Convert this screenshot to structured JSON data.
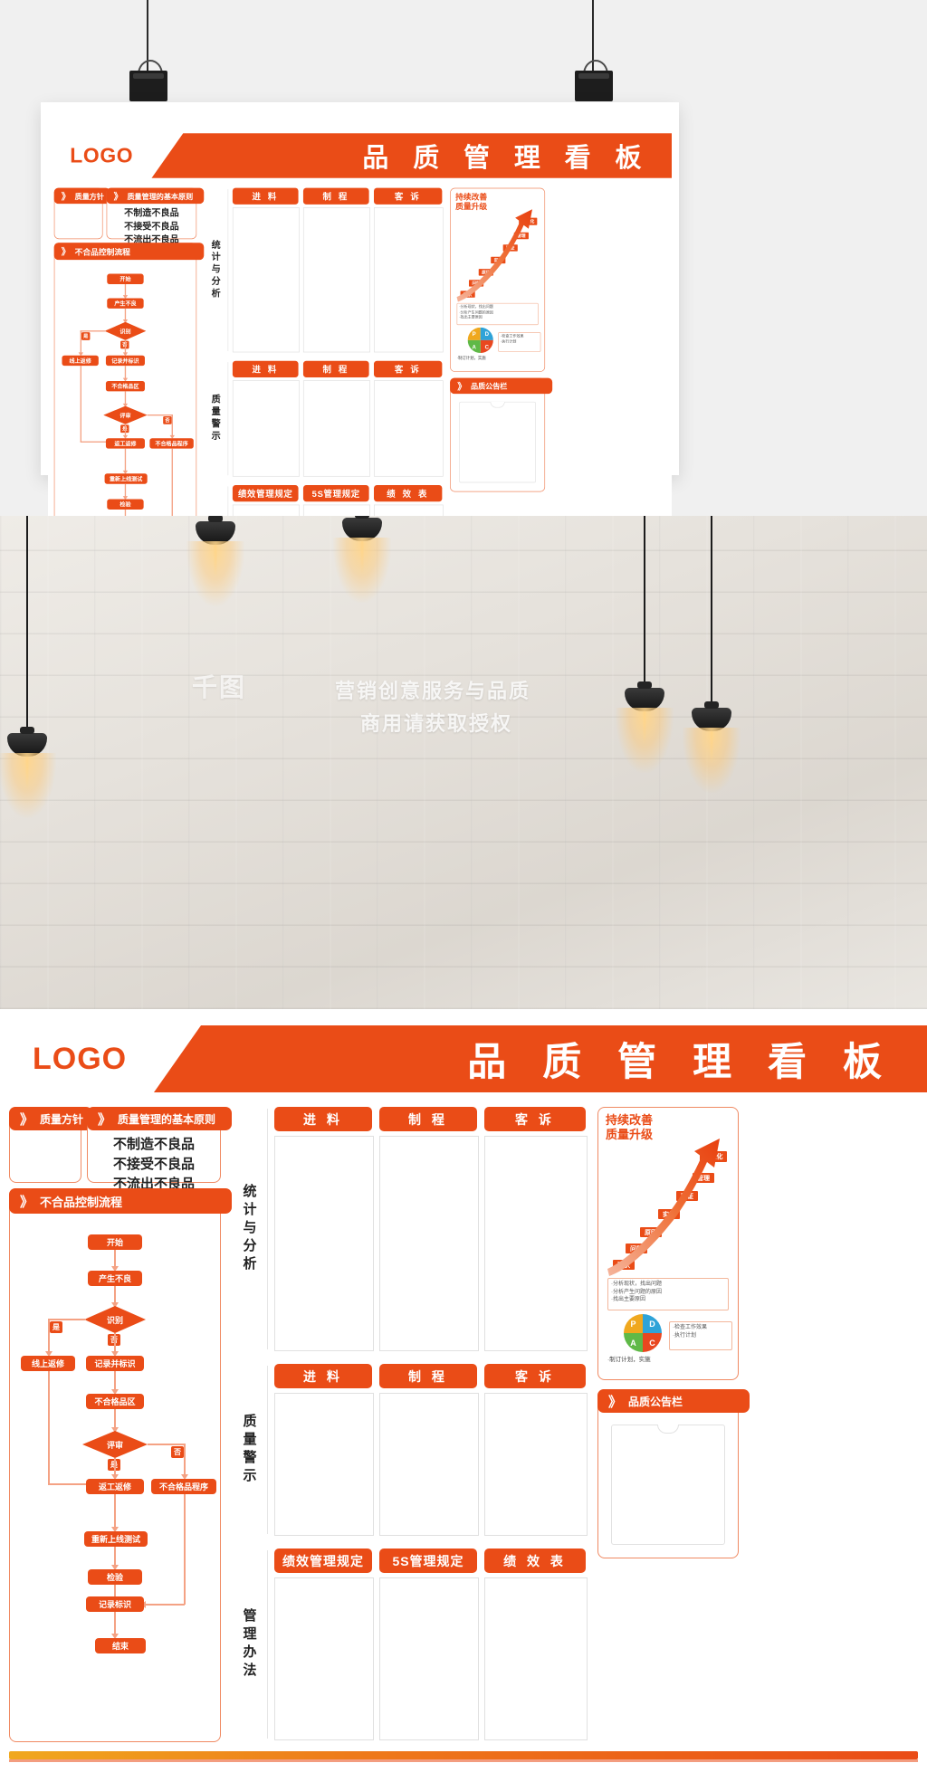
{
  "brand": {
    "logo": "LOGO",
    "accent": "#ea4c17",
    "accent_light": "#f4a284",
    "gold": "#f0a81e"
  },
  "board": {
    "title": "品 质 管 理 看 板",
    "left": {
      "policy": {
        "header": "质量方针",
        "chevron": "》"
      },
      "principle": {
        "header": "质量管理的基本原则",
        "chevron": "》",
        "lines": [
          "不制造不良品",
          "不接受不良品",
          "不流出不良品"
        ]
      },
      "flow": {
        "header": "不合品控制流程",
        "chevron": "》",
        "nodes": [
          "开始",
          "产生不良",
          "识别",
          "线上返修",
          "记录并标识",
          "不合格品区",
          "评审",
          "返工返修",
          "不合格品程序",
          "重新上线测试",
          "检验",
          "记录标识",
          "结束"
        ],
        "branch_yes": "是",
        "branch_no": "否",
        "branch_no2": "否",
        "branch_yes2": "是"
      }
    },
    "sections": [
      {
        "label": "统计与分析",
        "columns": [
          "进 料",
          "制 程",
          "客 诉"
        ]
      },
      {
        "label": "质量警示",
        "columns": [
          "进 料",
          "制 程",
          "客 诉"
        ]
      },
      {
        "label": "管理办法",
        "columns": [
          "绩效管理规定",
          "5S管理规定",
          "绩 效 表"
        ]
      }
    ],
    "right": {
      "improve": {
        "title_line1": "持续改善",
        "title_line2": "质量升级",
        "steps": [
          "现状",
          "问题",
          "原因",
          "实施",
          "验证",
          "管理",
          "标准化"
        ],
        "pdca": [
          "P",
          "D",
          "C",
          "A"
        ],
        "pdca_colors": [
          "#f0a81e",
          "#2fa3d8",
          "#e9471f",
          "#5fb947"
        ],
        "notes": [
          "·分析现状，找出问题",
          "·分析产生问题的原因",
          "·找出主要原因",
          "·制订计划，实施"
        ],
        "notes2": [
          "·检查工作效果",
          "·执行计划"
        ]
      },
      "notice": {
        "header": "品质公告栏",
        "chevron": "》"
      }
    }
  },
  "mockup": {
    "watermark_line1": "营销创意服务与品质",
    "watermark_line2": "商用请获取授权",
    "watermark_mark": "千图"
  }
}
